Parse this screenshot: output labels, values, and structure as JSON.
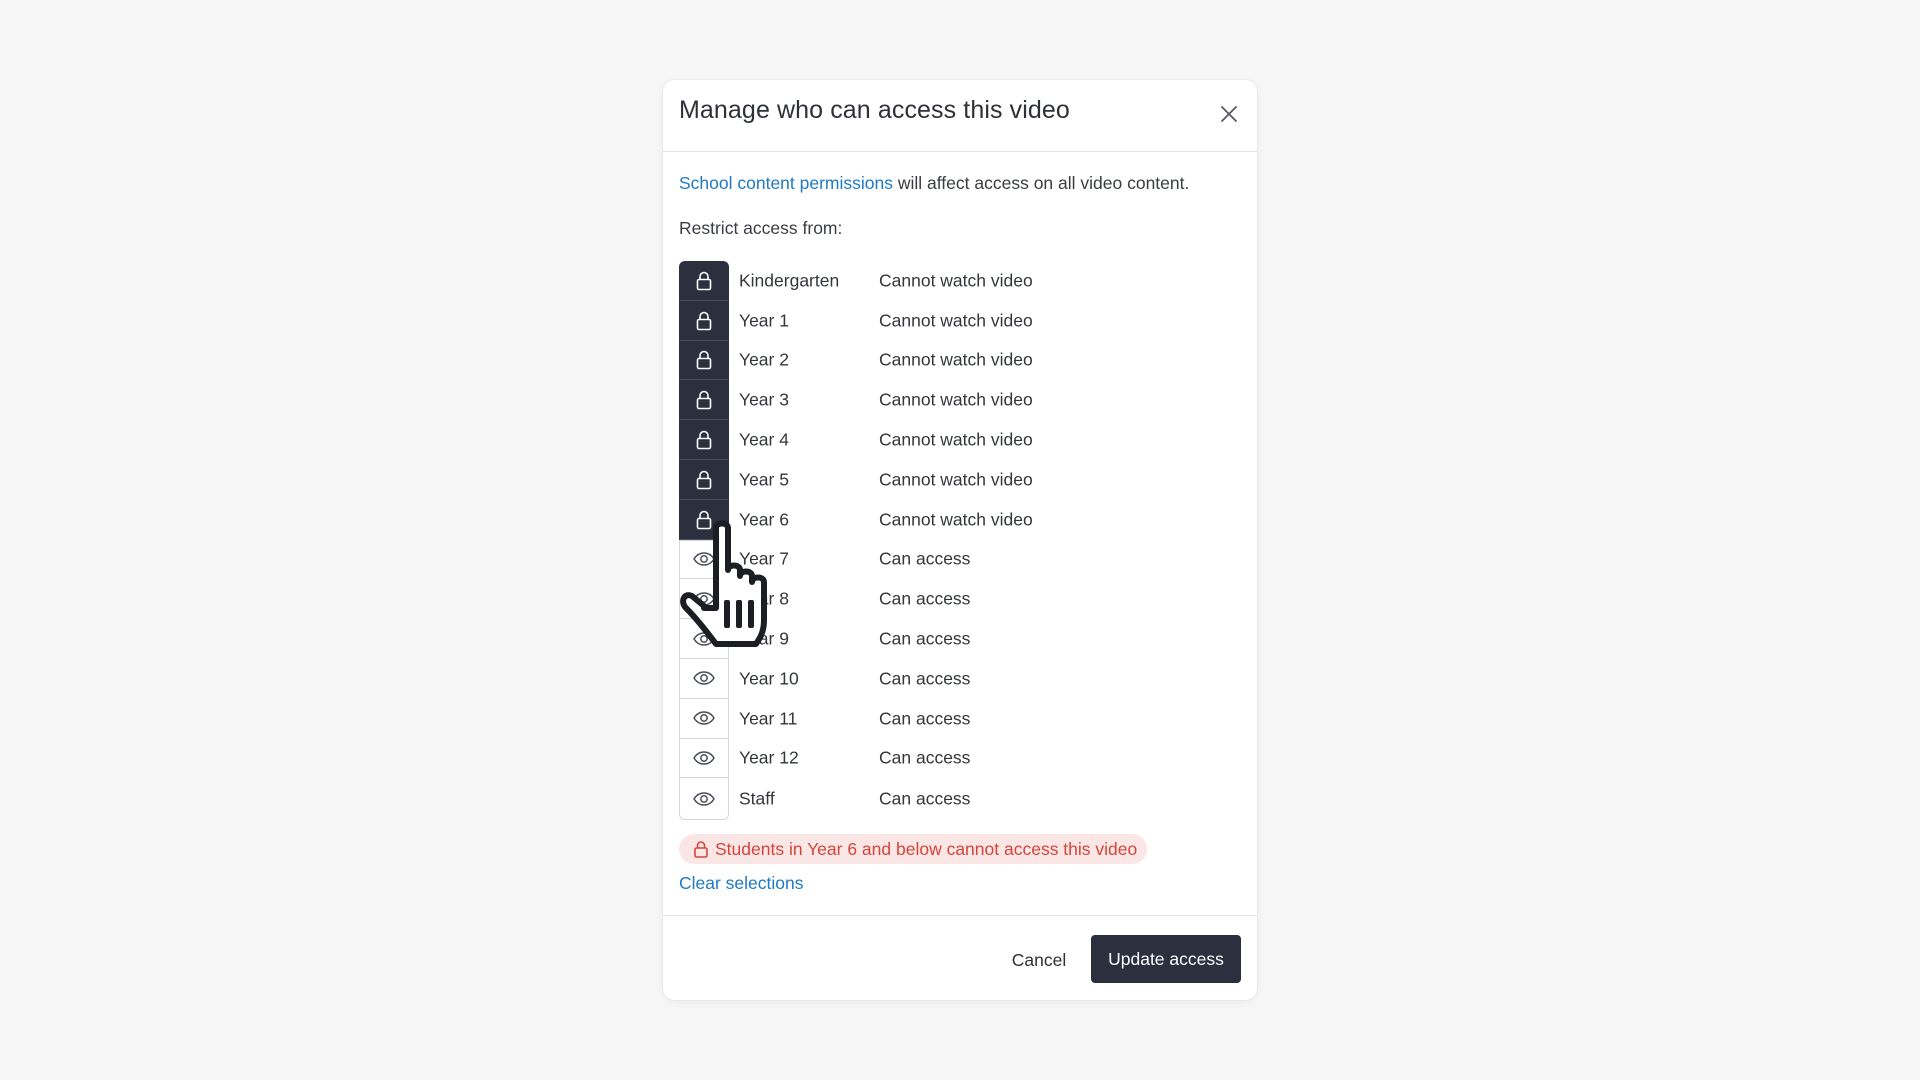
{
  "modal": {
    "title": "Manage who can access this video",
    "intro_link": "School content permissions",
    "intro_rest": " will affect access on all video content.",
    "restrict_label": "Restrict access from:",
    "rows": [
      {
        "name": "Kindergarten",
        "status": "Cannot watch video",
        "locked": true
      },
      {
        "name": "Year 1",
        "status": "Cannot watch video",
        "locked": true
      },
      {
        "name": "Year 2",
        "status": "Cannot watch video",
        "locked": true
      },
      {
        "name": "Year 3",
        "status": "Cannot watch video",
        "locked": true
      },
      {
        "name": "Year 4",
        "status": "Cannot watch video",
        "locked": true
      },
      {
        "name": "Year 5",
        "status": "Cannot watch video",
        "locked": true
      },
      {
        "name": "Year 6",
        "status": "Cannot watch video",
        "locked": true
      },
      {
        "name": "Year 7",
        "status": "Can access",
        "locked": false
      },
      {
        "name": "Year 8",
        "status": "Can access",
        "locked": false
      },
      {
        "name": "Year 9",
        "status": "Can access",
        "locked": false
      },
      {
        "name": "Year 10",
        "status": "Can access",
        "locked": false
      },
      {
        "name": "Year 11",
        "status": "Can access",
        "locked": false
      },
      {
        "name": "Year 12",
        "status": "Can access",
        "locked": false
      },
      {
        "name": "Staff",
        "status": "Can access",
        "locked": false
      }
    ],
    "warning": "Students in Year 6 and below cannot access this video",
    "clear_label": "Clear selections",
    "cancel_label": "Cancel",
    "update_label": "Update access"
  },
  "colors": {
    "dark": "#2b2f3e",
    "link": "#1f7ac4",
    "warning_text": "#d5453a",
    "warning_bg": "#fbe6e6"
  },
  "icons": {
    "locked": "lock-icon",
    "open": "eye-icon",
    "close": "close-icon",
    "cursor": "hand-pointer-icon"
  }
}
